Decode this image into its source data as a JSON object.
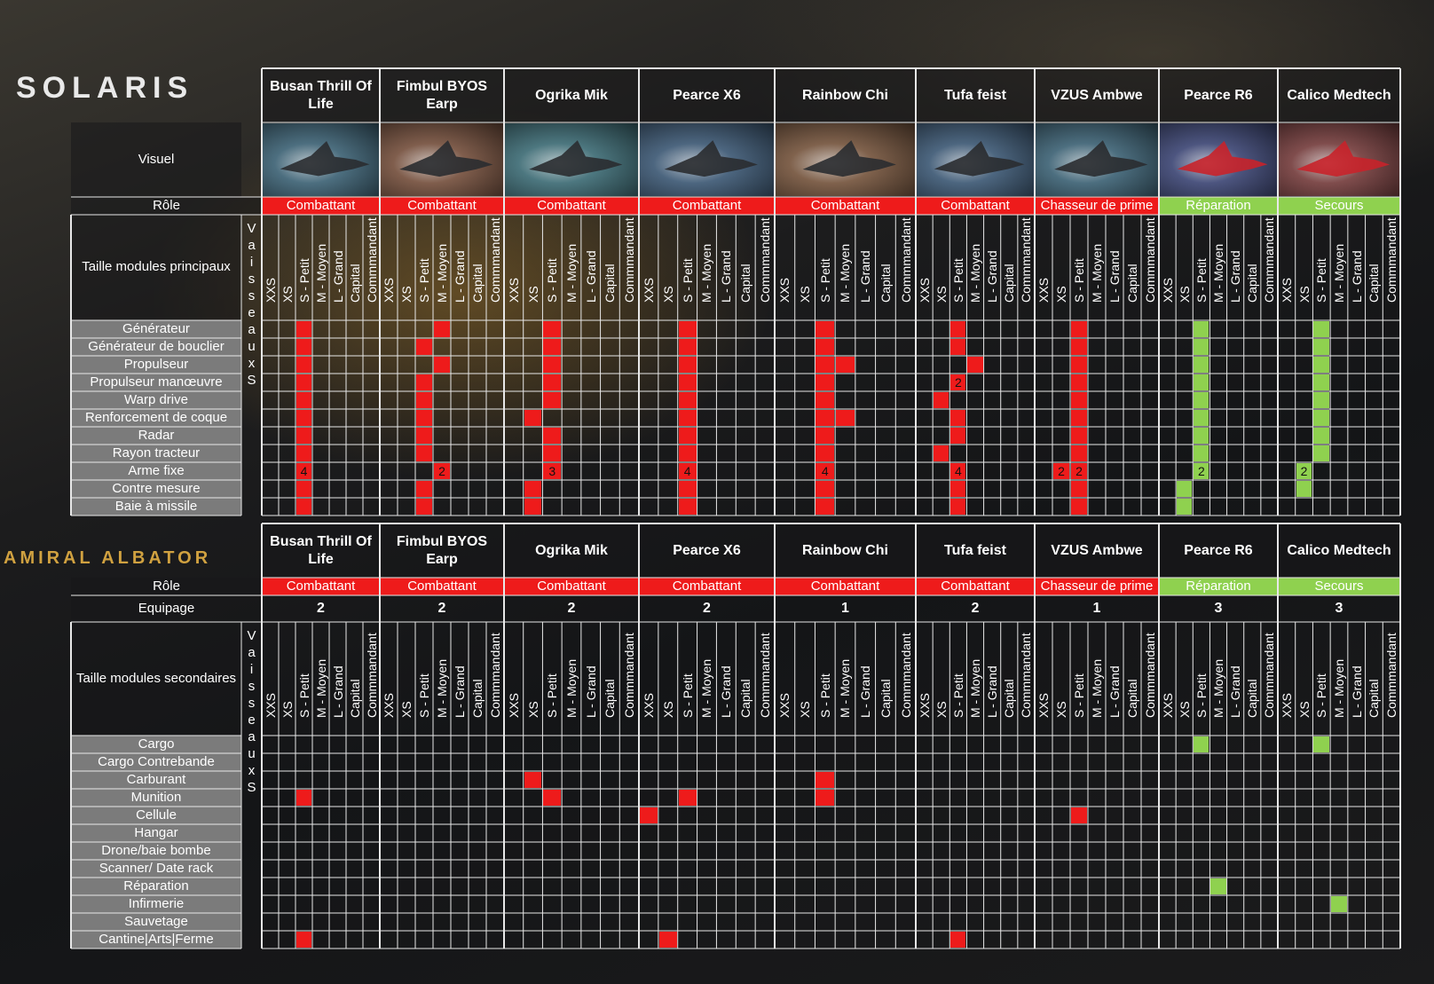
{
  "brand": {
    "solaris": "SOLARIS",
    "amiral": "AMIRAL ALBATOR"
  },
  "colors": {
    "red": "#ee1b1b",
    "green": "#8fd14f",
    "grid": "#e8e8e8",
    "grey": "#7b7b7b"
  },
  "side_label": "VaisseauxS",
  "size_labels": [
    "XXS",
    "XS",
    "S - Petit",
    "M - Moyen",
    "L - Grand",
    "Capital",
    "Commmandant"
  ],
  "ships": [
    {
      "name": "Busan Thrill Of Life",
      "role": "Combattant",
      "role_type": "red",
      "crew": "2"
    },
    {
      "name": "Fimbul BYOS Earp",
      "role": "Combattant",
      "role_type": "red",
      "crew": "2"
    },
    {
      "name": "Ogrika Mik",
      "role": "Combattant",
      "role_type": "red",
      "crew": "2"
    },
    {
      "name": "Pearce X6",
      "role": "Combattant",
      "role_type": "red",
      "crew": "2"
    },
    {
      "name": "Rainbow Chi",
      "role": "Combattant",
      "role_type": "red",
      "crew": "1"
    },
    {
      "name": "Tufa feist",
      "role": "Combattant",
      "role_type": "red",
      "crew": "2"
    },
    {
      "name": "VZUS Ambwe",
      "role": "Chasseur de prime",
      "role_type": "red",
      "crew": "1"
    },
    {
      "name": "Pearce R6",
      "role": "Réparation",
      "role_type": "green",
      "crew": "3"
    },
    {
      "name": "Calico Medtech",
      "role": "Secours",
      "role_type": "green",
      "crew": "3"
    }
  ],
  "top": {
    "visuel_label": "Visuel",
    "role_label": "Rôle",
    "size_header_label": "Taille modules principaux",
    "rows": [
      "Générateur",
      "Générateur de bouclier",
      "Propulseur",
      "Propulseur manœuvre",
      "Warp drive",
      "Renforcement de coque",
      "Radar",
      "Rayon tracteur",
      "Arme fixe",
      "Contre mesure",
      "Baie à missile"
    ],
    "marks": [
      [
        [
          2
        ],
        [
          2
        ],
        [
          2
        ],
        [
          2
        ],
        [
          2
        ],
        [
          2
        ],
        [
          2
        ],
        [
          2
        ],
        [
          2,
          "4"
        ],
        [
          2
        ],
        [
          2
        ]
      ],
      [
        [
          3
        ],
        [
          2
        ],
        [
          3
        ],
        [
          2
        ],
        [
          2
        ],
        [
          2
        ],
        [
          2
        ],
        [
          2
        ],
        [
          3,
          "2"
        ],
        [
          2
        ],
        [
          2
        ]
      ],
      [
        [
          2
        ],
        [
          2
        ],
        [
          2
        ],
        [
          2
        ],
        [
          2
        ],
        [
          1
        ],
        [
          2
        ],
        [
          2
        ],
        [
          2,
          "3"
        ],
        [
          1
        ],
        [
          1
        ]
      ],
      [
        [
          2
        ],
        [
          2
        ],
        [
          2
        ],
        [
          2
        ],
        [
          2
        ],
        [
          2
        ],
        [
          2
        ],
        [
          2
        ],
        [
          2,
          "4"
        ],
        [
          2
        ],
        [
          2
        ]
      ],
      [
        [
          2
        ],
        [
          2
        ],
        [
          2,
          3
        ],
        [
          2
        ],
        [
          2
        ],
        [
          2,
          3
        ],
        [
          2
        ],
        [
          2
        ],
        [
          2,
          "4"
        ],
        [
          2
        ],
        [
          2
        ]
      ],
      [
        [
          2
        ],
        [
          2
        ],
        [
          3
        ],
        [
          2,
          "2"
        ],
        [
          1
        ],
        [
          2
        ],
        [
          2
        ],
        [
          1
        ],
        [
          2,
          "4"
        ],
        [
          2
        ],
        [
          2
        ]
      ],
      [
        [
          2
        ],
        [
          2
        ],
        [
          2
        ],
        [
          2
        ],
        [
          2
        ],
        [
          2
        ],
        [
          2
        ],
        [
          2
        ],
        [
          1,
          "2",
          2,
          "2"
        ],
        [
          2
        ],
        [
          2
        ]
      ]
    ],
    "green_marks": [
      [
        [
          2
        ],
        [
          2
        ],
        [
          2
        ],
        [
          2
        ],
        [
          2
        ],
        [
          2
        ],
        [
          2
        ],
        [
          2
        ],
        [
          2,
          "2"
        ],
        [
          1
        ],
        [
          1
        ]
      ],
      [
        [
          2
        ],
        [
          2
        ],
        [
          2
        ],
        [
          2
        ],
        [
          2
        ],
        [
          2
        ],
        [
          2
        ],
        [
          2
        ],
        [
          1,
          "2"
        ],
        [
          1
        ],
        []
      ]
    ]
  },
  "bottom": {
    "role_label": "Rôle",
    "crew_label": "Equipage",
    "size_header_label": "Taille modules secondaires",
    "rows": [
      "Cargo",
      "Cargo Contrebande",
      "Carburant",
      "Munition",
      "Cellule",
      "Hangar",
      "Drone/baie bombe",
      "Scanner/ Date rack",
      "Réparation",
      "Infirmerie",
      "Sauvetage",
      "Cantine|Arts|Ferme"
    ],
    "marks": [
      {
        "ship": 0,
        "row": 3,
        "col": 2
      },
      {
        "ship": 0,
        "row": 11,
        "col": 2
      },
      {
        "ship": 2,
        "row": 2,
        "col": 1
      },
      {
        "ship": 2,
        "row": 3,
        "col": 2
      },
      {
        "ship": 3,
        "row": 3,
        "col": 2
      },
      {
        "ship": 3,
        "row": 4,
        "col": 0
      },
      {
        "ship": 3,
        "row": 11,
        "col": 1
      },
      {
        "ship": 4,
        "row": 2,
        "col": 2
      },
      {
        "ship": 4,
        "row": 3,
        "col": 2
      },
      {
        "ship": 5,
        "row": 11,
        "col": 2
      },
      {
        "ship": 6,
        "row": 4,
        "col": 2
      }
    ],
    "green_marks": [
      {
        "ship": 7,
        "row": 0,
        "col": 2
      },
      {
        "ship": 7,
        "row": 8,
        "col": 3
      },
      {
        "ship": 8,
        "row": 0,
        "col": 2
      },
      {
        "ship": 8,
        "row": 9,
        "col": 3
      }
    ]
  }
}
